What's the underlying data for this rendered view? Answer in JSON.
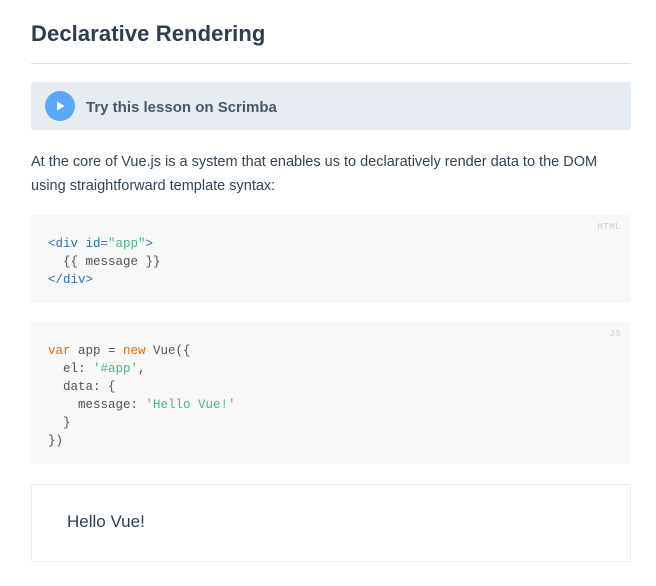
{
  "page": {
    "title": "Declarative Rendering"
  },
  "scrimba": {
    "label": "Try this lesson on Scrimba"
  },
  "intro": {
    "text": "At the core of Vue.js is a system that enables us to declaratively render data to the DOM using straightforward template syntax:"
  },
  "html_example": {
    "lang": "HTML",
    "tokens": {
      "open_tag_start": "<div",
      "attr_name": " id=",
      "attr_value": "\"app\"",
      "open_tag_end": ">",
      "mustache": "  {{ message }}",
      "close_tag": "</div>"
    }
  },
  "js_example": {
    "lang": "JS",
    "tokens": {
      "kw_var": "var",
      "app_assign": " app = ",
      "kw_new": "new",
      "vue_open": " Vue({",
      "el_key": "  el: ",
      "el_value": "'#app'",
      "el_comma": ",",
      "data_open": "  data: {",
      "message_key": "    message: ",
      "message_value": "'Hello Vue!'",
      "data_close": "  }",
      "vue_close": "})"
    }
  },
  "result": {
    "text": "Hello Vue!"
  },
  "colors": {
    "scrimba_play": "#5ba7f7",
    "scrimba_bg": "#e7ecf3",
    "code_bg": "#f8f8f8",
    "keyword": "#e96900",
    "string": "#42b983",
    "tag": "#2973b7"
  },
  "icons": {
    "scrimba_play": "play-icon"
  }
}
